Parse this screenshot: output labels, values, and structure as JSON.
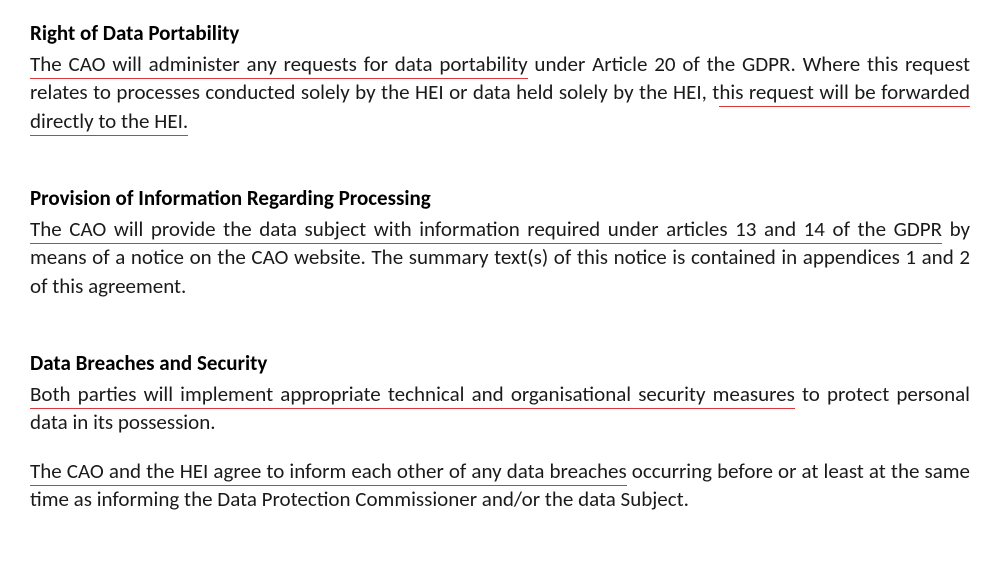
{
  "section1": {
    "heading": "Right of Data Portability",
    "p1_part1": "The CAO will administer any requests for data portability",
    "p1_part2": " under Article 20 of the GDPR. Where this request relates to processes conducted solely by the HEI or data held solely by the HEI, t",
    "p1_part3": "his request will be forwarded directly to the HEI."
  },
  "section2": {
    "heading": "Provision of Information Regarding Processing",
    "p1_part1": "The CAO will provide the data subject with information required under articles 13 and 14 of the GDPR",
    "p1_part2": " by means of a notice on the CAO website. The summary text(s) of this notice is contained in appendices 1 and 2 of this agreement."
  },
  "section3": {
    "heading": "Data Breaches and Security",
    "p1_part1": "Both parties will implement appropriate technical and organisational security measures",
    "p1_part2": " to protect personal data in its possession.",
    "p2_part1": "The CAO and the HEI agree to inform each other of any data breaches",
    "p2_part2": " occurring before or at least at the same time as informing the Data Protection Commissioner and/or the data Subject."
  }
}
